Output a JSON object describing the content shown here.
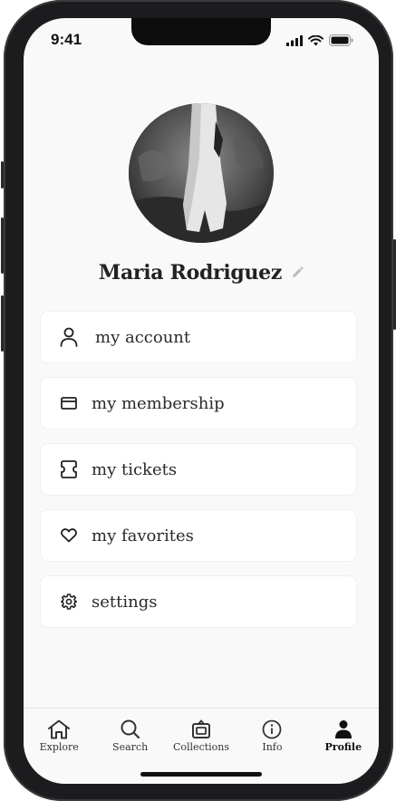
{
  "status_bar": {
    "time": "9:41"
  },
  "profile": {
    "name": "Maria Rodriguez"
  },
  "menu": [
    {
      "label": "my account",
      "icon": "user-icon"
    },
    {
      "label": "my membership",
      "icon": "card-icon"
    },
    {
      "label": "my tickets",
      "icon": "ticket-icon"
    },
    {
      "label": "my favorites",
      "icon": "heart-icon"
    },
    {
      "label": "settings",
      "icon": "gear-icon"
    }
  ],
  "tabs": [
    {
      "label": "Explore",
      "icon": "home-icon",
      "active": false
    },
    {
      "label": "Search",
      "icon": "search-icon",
      "active": false
    },
    {
      "label": "Collections",
      "icon": "collections-icon",
      "active": false
    },
    {
      "label": "Info",
      "icon": "info-icon",
      "active": false
    },
    {
      "label": "Profile",
      "icon": "profile-icon",
      "active": true
    }
  ]
}
